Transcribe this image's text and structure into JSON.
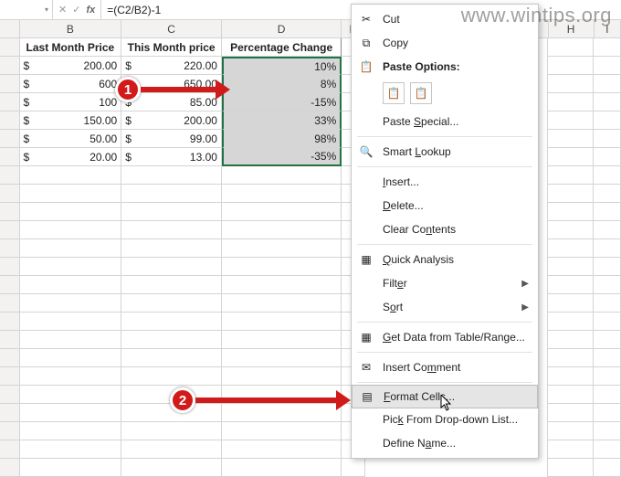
{
  "watermark": "www.wintips.org",
  "formula_bar": {
    "name_box": "",
    "fx_label": "fx",
    "formula": "=(C2/B2)-1"
  },
  "columns": [
    {
      "id": "B",
      "width": 114
    },
    {
      "id": "C",
      "width": 112
    },
    {
      "id": "D",
      "width": 134
    },
    {
      "id": "E",
      "width": 26
    },
    {
      "id": "H",
      "width": 84
    },
    {
      "id": "I",
      "width": 30
    }
  ],
  "col_widths": {
    "B": 114,
    "C": 112,
    "D": 134
  },
  "headers": {
    "B": "Last Month Price",
    "C": "This Month price",
    "D": "Percentage Change"
  },
  "rows": [
    {
      "B_sym": "$",
      "B_val": "200.00",
      "C_sym": "$",
      "C_val": "220.00",
      "D": "10%"
    },
    {
      "B_sym": "$",
      "B_val": "600",
      "C_sym": "$",
      "C_val": "650.00",
      "D": "8%"
    },
    {
      "B_sym": "$",
      "B_val": "100",
      "C_sym": "$",
      "C_val": "85.00",
      "D": "-15%"
    },
    {
      "B_sym": "$",
      "B_val": "150.00",
      "C_sym": "$",
      "C_val": "200.00",
      "D": "33%"
    },
    {
      "B_sym": "$",
      "B_val": "50.00",
      "C_sym": "$",
      "C_val": "99.00",
      "D": "98%"
    },
    {
      "B_sym": "$",
      "B_val": "20.00",
      "C_sym": "$",
      "C_val": "13.00",
      "D": "-35%"
    }
  ],
  "empty_rows": 17,
  "context_menu": {
    "cut": "Cut",
    "copy": "Copy",
    "paste_options_label": "Paste Options:",
    "paste_special": "Paste Special...",
    "smart_lookup": "Smart Lookup",
    "insert": "Insert...",
    "delete": "Delete...",
    "clear_contents": "Clear Contents",
    "quick_analysis": "Quick Analysis",
    "filter": "Filter",
    "sort": "Sort",
    "get_data": "Get Data from Table/Range...",
    "insert_comment": "Insert Comment",
    "format_cells": "Format Cells...",
    "pick_list": "Pick From Drop-down List...",
    "define_name": "Define Name..."
  },
  "callouts": {
    "one": "1",
    "two": "2"
  }
}
